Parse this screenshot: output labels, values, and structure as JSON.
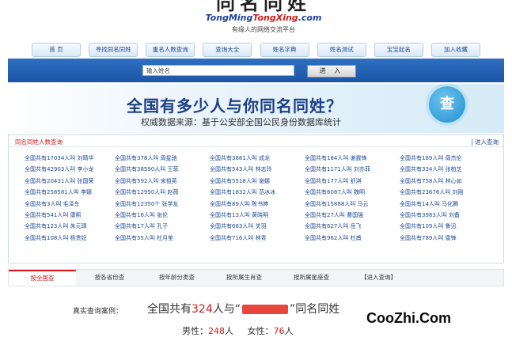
{
  "header": {
    "logo_cn": "同名同姓",
    "logo_en_part1": "TongMing",
    "logo_en_part2": "TongXing",
    "logo_en_part3": ".com",
    "slogan": "有缘人的网络交流平台"
  },
  "nav": [
    "首 页",
    "寻找同名同姓",
    "重名人数查询",
    "查询大全",
    "姓名字典",
    "姓名测试",
    "宝宝起名",
    "加入收藏"
  ],
  "search": {
    "placeholder": "输入姓名",
    "button": "进 入"
  },
  "banner": {
    "title": "全国有多少人与你同名同姓？",
    "subtitle": "权威数据来源：基于公安部全国公民身份数据库统计",
    "badge": "查"
  },
  "list": {
    "heading": "同名同姓人数查询",
    "more": "进入查询",
    "items": [
      "全国共有17034人叫 刘晴华",
      "全国共有378人叫 周星驰",
      "全国共有3881人叫 成龙",
      "全国共有184人叫 谢霆锋",
      "全国共有189人叫 周杰伦",
      "全国共有42903人叫 李小龙",
      "全国共有38590人叫 王菲",
      "全国共有543人叫 林志玲",
      "全国共有1171人叫 刘亦菲",
      "全国共有334人叫 张柏芝",
      "全国共有20431人叫 张国荣",
      "全国共有592人叫 宋祖英",
      "全国共有5518人叫 谢娜",
      "全国共有177人叫 舒淇",
      "全国共有758人叫 林心如",
      "全国共有258581人叫 李娜",
      "全国共有12950人叫 赵薇",
      "全国共有1832人叫 范冰冰",
      "全国共有6087人叫 魏明",
      "全国共有23676人叫 刘刚",
      "全国共有3人叫 毛泽东",
      "全国共有12350个 张学友",
      "全国共有89人叫 陈书婷",
      "全国共有15888人叫 马云",
      "全国共有14人叫 马化腾",
      "全国共有541人叫 康熙",
      "全国共有16人叫 张伦",
      "全国共有13人叫 黄晓明",
      "全国共有27人叫 曹国强",
      "全国共有3983人叫 刘备",
      "全国共有123人叫 朱元璋",
      "全国共有17人叫 孔子",
      "全国共有663人叫 关羽",
      "全国共有627人叫 岳飞",
      "全国共有109人叫 鲁迅",
      "全国共有108人叫 杨贵妃",
      "全国共有55人叫 杜月笙",
      "全国共有716人叫 林青",
      "全国共有962人叫 杜甫",
      "全国共有789人叫 雷锋"
    ]
  },
  "tabs": [
    "按全国查",
    "按各省份查",
    "按年龄分类查",
    "按所属生肖查",
    "按所属星座查",
    "【进入查询】"
  ],
  "example": {
    "label": "真实查询案例：",
    "prefix": "全国共有",
    "count": "324",
    "mid": "人与“",
    "suffix": "”同名同姓",
    "male_label": "男性：",
    "male_count": "248",
    "female_label": "女性：",
    "female_count": "76",
    "unit": "人"
  },
  "watermark": "CooZhi.Com"
}
